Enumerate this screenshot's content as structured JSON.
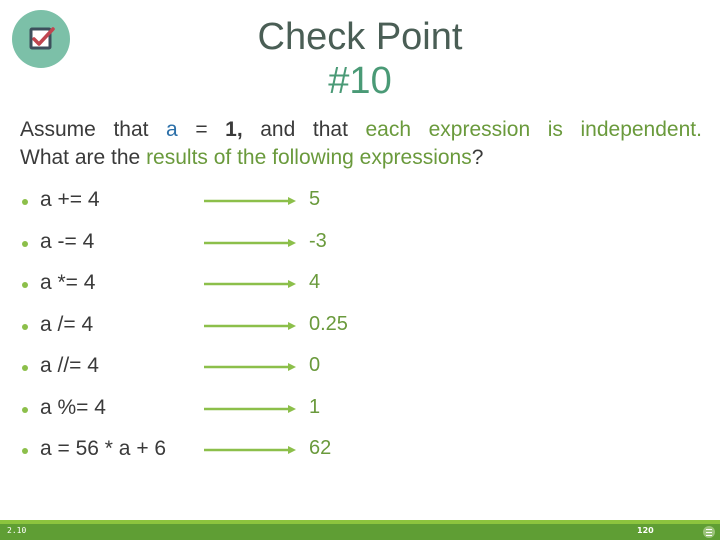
{
  "header": {
    "logo_icon": "checkbox-check-icon",
    "title_line1": "Check Point",
    "title_line2": "#10"
  },
  "intro": {
    "line1": [
      {
        "text": "Assume",
        "style": "normal"
      },
      {
        "text": "that",
        "style": "normal"
      },
      {
        "text": "a",
        "style": "blue"
      },
      {
        "text": "=",
        "style": "normal"
      },
      {
        "text": "1,",
        "style": "bold"
      },
      {
        "text": "and",
        "style": "normal"
      },
      {
        "text": "that",
        "style": "normal"
      },
      {
        "text": "each",
        "style": "green"
      },
      {
        "text": "expression",
        "style": "green"
      },
      {
        "text": "is",
        "style": "green"
      },
      {
        "text": "independent.",
        "style": "green"
      }
    ],
    "line2_part1": "What are the ",
    "line2_part2": "results of the following expressions",
    "line2_part3": "?"
  },
  "items": [
    {
      "expr": "a += 4",
      "result": "5"
    },
    {
      "expr": "a -= 4",
      "result": "-3"
    },
    {
      "expr": "a *= 4",
      "result": "4"
    },
    {
      "expr": "a /= 4",
      "result": "0.25"
    },
    {
      "expr": "a //= 4",
      "result": "0"
    },
    {
      "expr": "a %= 4",
      "result": "1"
    },
    {
      "expr": "a = 56 * a + 6",
      "result": "62"
    }
  ],
  "footer": {
    "left_label": "2.10",
    "page_number": "120",
    "menu_icon": "menu-icon"
  },
  "colors": {
    "accent_green": "#6a9a3c",
    "arrow_green": "#8cbf4a",
    "footer_green": "#5f9e34",
    "title_teal": "#4a9a76",
    "variable_blue": "#2b6fa8"
  }
}
